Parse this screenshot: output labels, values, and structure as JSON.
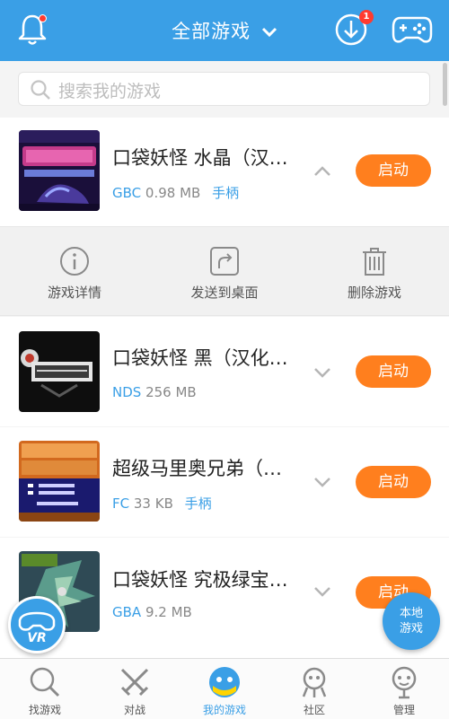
{
  "header": {
    "title": "全部游戏",
    "download_badge": "1",
    "bell_icon": "bell-icon",
    "download_icon": "download-icon",
    "gamepad_icon": "gamepad-icon"
  },
  "search": {
    "placeholder": "搜索我的游戏"
  },
  "games": [
    {
      "name": "口袋妖怪 水晶（汉…",
      "platform": "GBC",
      "size": "0.98 MB",
      "controller": "手柄",
      "action": "启动"
    },
    {
      "name": "口袋妖怪 黑（汉化…",
      "platform": "NDS",
      "size": "256 MB",
      "controller": "",
      "action": "启动"
    },
    {
      "name": "超级马里奥兄弟（…",
      "platform": "FC",
      "size": "33 KB",
      "controller": "手柄",
      "action": "启动"
    },
    {
      "name": "口袋妖怪 究极绿宝…",
      "platform": "GBA",
      "size": "9.2 MB",
      "controller": "",
      "action": "启动"
    }
  ],
  "actions": [
    {
      "label": "游戏详情"
    },
    {
      "label": "发送到桌面"
    },
    {
      "label": "删除游戏"
    }
  ],
  "floating": {
    "vr_label": "VR",
    "local_games": [
      "本地",
      "游戏"
    ]
  },
  "nav": [
    {
      "label": "找游戏"
    },
    {
      "label": "对战"
    },
    {
      "label": "我的游戏"
    },
    {
      "label": "社区"
    },
    {
      "label": "管理"
    }
  ],
  "colors": {
    "primary": "#3a9fe6",
    "accent": "#ff7f1e",
    "badge": "#ff3b30"
  }
}
